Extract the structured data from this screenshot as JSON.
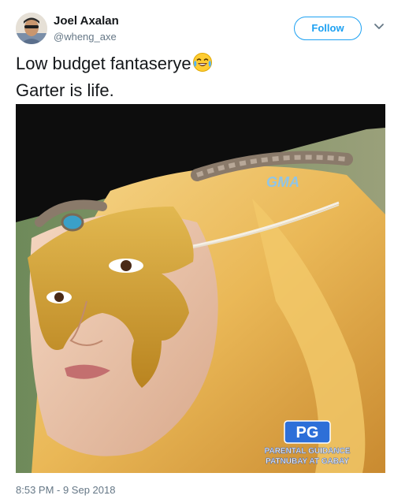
{
  "author": {
    "display_name": "Joel Axalan",
    "handle": "@wheng_axe"
  },
  "follow_button": {
    "label": "Follow"
  },
  "tweet": {
    "text_line_1": "Low budget fantaserye",
    "text_line_2": "Garter is life.",
    "emoji": "face-with-tears-of-joy",
    "timestamp": "8:53 PM - 9 Sep 2018"
  },
  "media": {
    "network_logo": "GMA",
    "rating_badge": "PG",
    "rating_line_1": "PARENTAL GUIDANCE",
    "rating_line_2": "PATNUBAY AT GABAY"
  },
  "colors": {
    "accent": "#1da1f2",
    "text_primary": "#14171a",
    "text_secondary": "#657786"
  }
}
